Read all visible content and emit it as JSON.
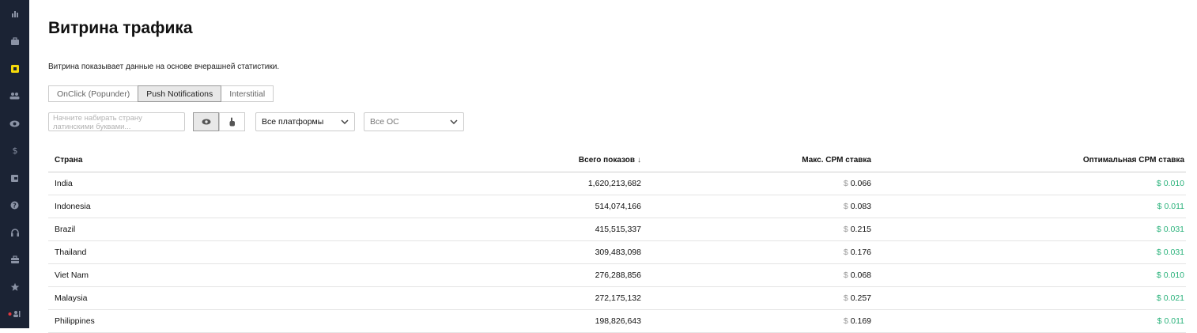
{
  "sidebar": {
    "icons": [
      {
        "name": "stats-icon"
      },
      {
        "name": "briefcase-icon"
      },
      {
        "name": "traffic-showcase-icon"
      },
      {
        "name": "users-icon"
      },
      {
        "name": "eye-icon"
      },
      {
        "name": "dollar-icon"
      },
      {
        "name": "wallet-icon"
      },
      {
        "name": "help-icon"
      },
      {
        "name": "headset-icon"
      },
      {
        "name": "toolbox-icon"
      },
      {
        "name": "star-icon"
      },
      {
        "name": "user-status-icon"
      }
    ]
  },
  "page": {
    "title": "Витрина трафика",
    "description": "Витрина показывает данные на основе вчерашней статистики."
  },
  "tabs": [
    {
      "label": "OnClick (Popunder)",
      "active": false
    },
    {
      "label": "Push Notifications",
      "active": true
    },
    {
      "label": "Interstitial",
      "active": false
    }
  ],
  "filters": {
    "search_placeholder": "Начните набирать страну латинскими буквами...",
    "platform_value": "Все платформы",
    "os_value": "Все ОС"
  },
  "table": {
    "headers": {
      "country": "Страна",
      "total": "Всего показов",
      "sort_arrow": "↓",
      "max_cpm": "Макс. CPM ставка",
      "opt_cpm": "Оптимальная CPM ставка"
    },
    "currency": "$",
    "rows": [
      {
        "country": "India",
        "total": "1,620,213,682",
        "max": "0.066",
        "opt": "0.010"
      },
      {
        "country": "Indonesia",
        "total": "514,074,166",
        "max": "0.083",
        "opt": "0.011"
      },
      {
        "country": "Brazil",
        "total": "415,515,337",
        "max": "0.215",
        "opt": "0.031"
      },
      {
        "country": "Thailand",
        "total": "309,483,098",
        "max": "0.176",
        "opt": "0.031"
      },
      {
        "country": "Viet Nam",
        "total": "276,288,856",
        "max": "0.068",
        "opt": "0.010"
      },
      {
        "country": "Malaysia",
        "total": "272,175,132",
        "max": "0.257",
        "opt": "0.021"
      },
      {
        "country": "Philippines",
        "total": "198,826,643",
        "max": "0.169",
        "opt": "0.011"
      }
    ]
  },
  "colors": {
    "sidebar_bg": "#1b2334",
    "active_icon": "#f5d90a",
    "optimal_green": "#2ab27b"
  }
}
